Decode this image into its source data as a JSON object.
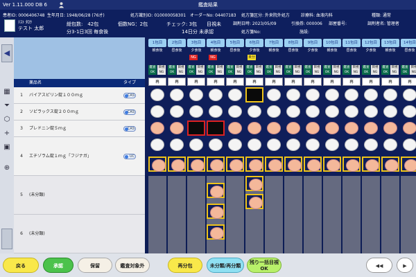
{
  "titlebar": {
    "version": "Ver 1.11.000 DB 6",
    "title": "鑑査結果"
  },
  "info": {
    "patient_id": "患者ID: 0006406748",
    "birth": "生年月日: 1948/06/28 (76才)",
    "rx_id": "処方識別ID: 010000058301",
    "order_no": "オーダーNo: 04407183",
    "rx_type": "処方箋区分: 外来院外処方",
    "dept": "診療科: 血液内科",
    "order_type": "種類: 通常",
    "reg_date": "調剤日時: 2023/05/09",
    "exchange_no": "引換券: 000006",
    "ward": "部屋番号:",
    "pharmacist": "調剤者名: 管理者",
    "rx_no": "処方箋No:",
    "facility": "施設:"
  },
  "patient": {
    "kana": "ﾃｽﾄ ﾀﾛｳ",
    "name": "テスト 太郎"
  },
  "stats": {
    "packs": "総包数:　42包",
    "ng": "個数NG：2包",
    "check": "チェック: 3包",
    "visual": "目視未",
    "days": "分3-1日3回 毎食後",
    "unapproved": "14日分 未承認"
  },
  "druglist": {
    "headers": {
      "name": "薬品名",
      "type": "タイプ"
    },
    "rows": [
      {
        "no": "1",
        "name": "バイアスピリン錠１００ｍｇ",
        "type": "CAS"
      },
      {
        "no": "2",
        "name": "ソピラックス錠２００ｍｇ",
        "type": "CAS"
      },
      {
        "no": "3",
        "name": "プレドニン錠５ｍｇ",
        "type": "CAS"
      },
      {
        "no": "4",
        "name": "エチゾラム錠１ｍｇ「フジナガ」",
        "type": "UC"
      },
      {
        "no": "5",
        "name": "(未分類)",
        "type": ""
      },
      {
        "no": "6",
        "name": "(未分類)",
        "type": ""
      }
    ]
  },
  "grid": {
    "columns": [
      {
        "label": "1包目",
        "time": "朝食後",
        "flag": ""
      },
      {
        "label": "2包目",
        "time": "昼食後",
        "flag": ""
      },
      {
        "label": "3包目",
        "time": "夕食後",
        "flag": "NG"
      },
      {
        "label": "4包目",
        "time": "朝食後",
        "flag": "NG"
      },
      {
        "label": "5包目",
        "time": "昼食後",
        "flag": ""
      },
      {
        "label": "6包目",
        "time": "夕食後",
        "flag": "未分"
      },
      {
        "label": "7包目",
        "time": "朝食後",
        "flag": ""
      },
      {
        "label": "8包目",
        "time": "昼食後",
        "flag": ""
      },
      {
        "label": "9包目",
        "time": "夕食後",
        "flag": ""
      },
      {
        "label": "10包目",
        "time": "朝食後",
        "flag": ""
      },
      {
        "label": "11包目",
        "time": "昼食後",
        "flag": ""
      },
      {
        "label": "12包目",
        "time": "夕食後",
        "flag": ""
      },
      {
        "label": "13包目",
        "time": "朝食後",
        "flag": ""
      },
      {
        "label": "14包目",
        "time": "昼食後",
        "flag": ""
      }
    ],
    "ok_label": "鑑査OK",
    "ng_label": "目視NG",
    "redo_label": "再"
  },
  "buttons": {
    "back": "戻る",
    "approve": "承認",
    "hold": "保留",
    "exclude": "鑑査対象外",
    "repack": "再分包",
    "unsorted": "未分類/再分類",
    "remaining": "残り一括目視OK",
    "prev": "◀◀",
    "next": "▶"
  }
}
